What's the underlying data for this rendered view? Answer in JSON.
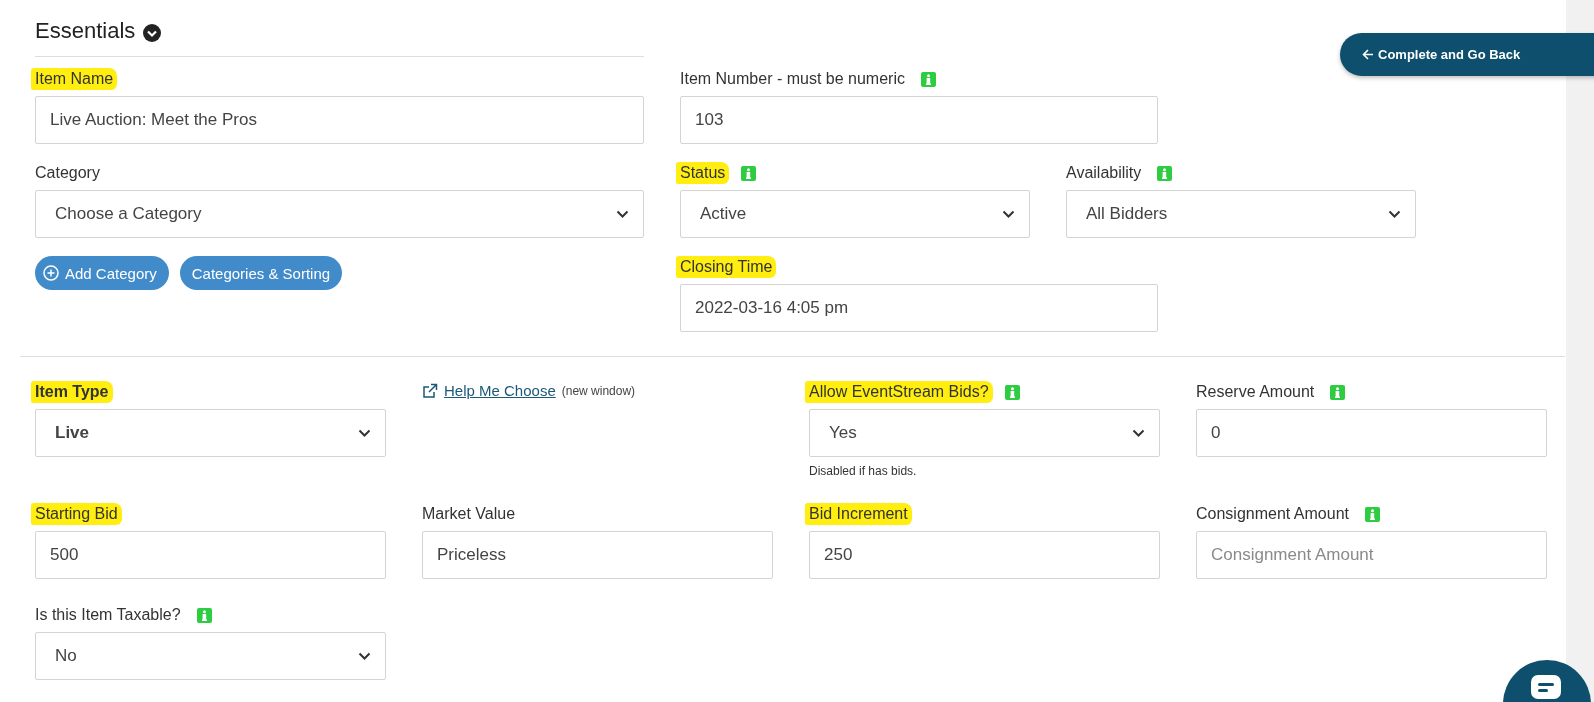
{
  "section": {
    "title": "Essentials"
  },
  "back_button": {
    "label": "Complete and Go Back"
  },
  "top_left": [
    {
      "kind": "text",
      "label": "Item Name",
      "highlighted": true,
      "info": false,
      "value": "Live Auction: Meet the Pros"
    },
    {
      "kind": "select",
      "label": "Category",
      "highlighted": false,
      "info": false,
      "value": "Choose a Category"
    }
  ],
  "category_buttons": [
    {
      "label": "Add Category",
      "kind": "add"
    },
    {
      "label": "Categories & Sorting",
      "kind": "plain"
    }
  ],
  "top_right_rows": [
    [
      {
        "kind": "text",
        "label": "Item Number - must be numeric",
        "highlighted": false,
        "info": true,
        "value": "103"
      }
    ],
    [
      {
        "kind": "select",
        "label": "Status",
        "highlighted": true,
        "info": true,
        "value": "Active"
      },
      {
        "kind": "select",
        "label": "Availability",
        "highlighted": false,
        "info": true,
        "value": "All Bidders"
      }
    ],
    [
      {
        "kind": "text",
        "label": "Closing Time",
        "highlighted": true,
        "info": false,
        "value": "2022-03-16 4:05 pm"
      }
    ]
  ],
  "details_rows": [
    [
      {
        "kind": "select",
        "label": "Item Type",
        "highlighted": true,
        "info": false,
        "bold": true,
        "value": "Live"
      },
      {
        "kind": "link",
        "label": "Help Me Choose",
        "note": "(new window)"
      },
      {
        "kind": "select",
        "label": "Allow EventStream Bids?",
        "highlighted": true,
        "info": true,
        "value": "Yes",
        "note": "Disabled if has bids."
      },
      {
        "kind": "text",
        "label": "Reserve Amount",
        "highlighted": false,
        "info": true,
        "value": "0"
      }
    ],
    [
      {
        "kind": "text",
        "label": "Starting Bid",
        "highlighted": true,
        "info": false,
        "value": "500"
      },
      {
        "kind": "text",
        "label": "Market Value",
        "highlighted": false,
        "info": false,
        "value": "Priceless"
      },
      {
        "kind": "text",
        "label": "Bid Increment",
        "highlighted": true,
        "info": false,
        "value": "250"
      },
      {
        "kind": "text",
        "label": "Consignment Amount",
        "highlighted": false,
        "info": true,
        "placeholder": "Consignment Amount"
      }
    ],
    [
      {
        "kind": "select",
        "label": "Is this Item Taxable?",
        "highlighted": false,
        "info": true,
        "value": "No"
      }
    ]
  ]
}
